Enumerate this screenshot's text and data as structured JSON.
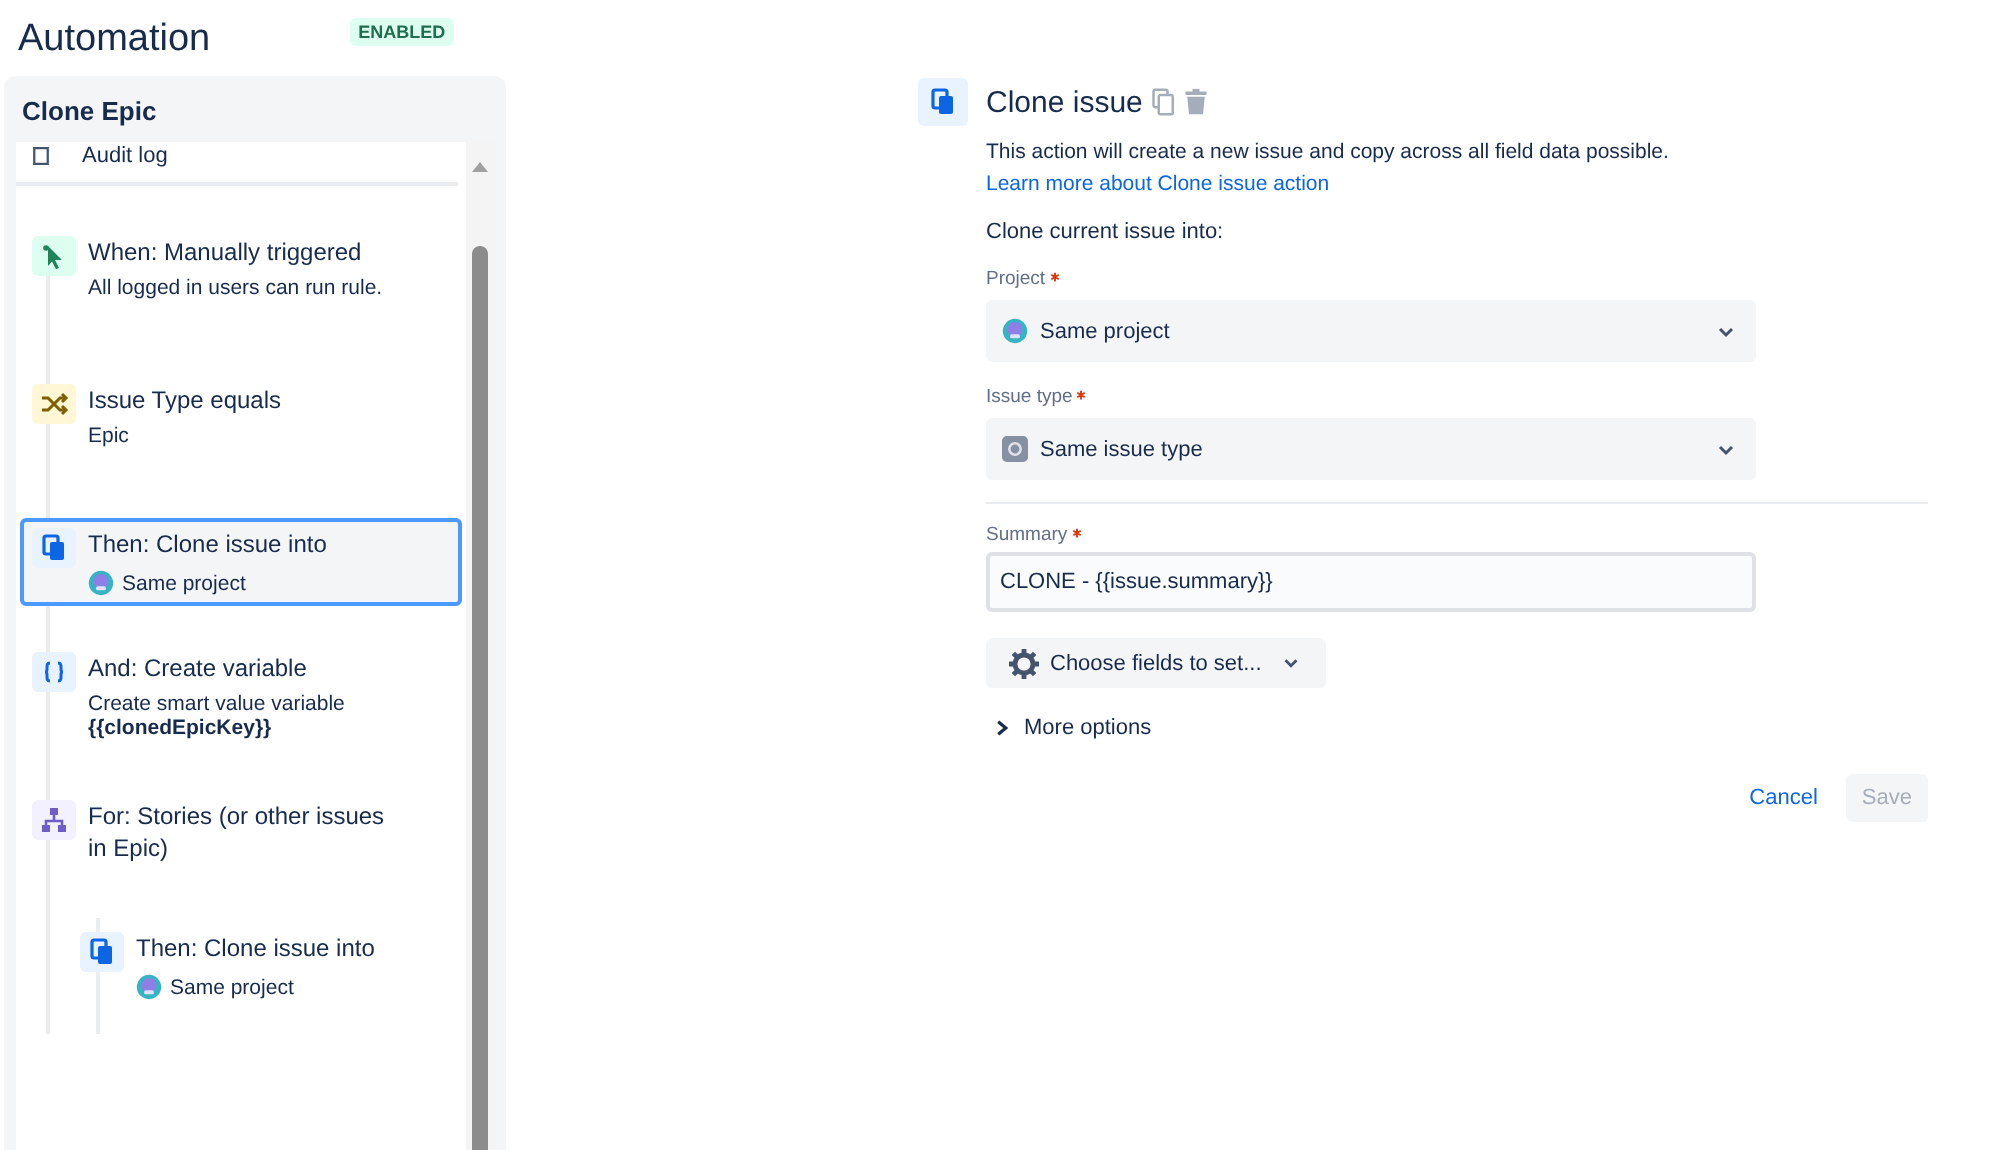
{
  "header": {
    "title": "Automation",
    "status": "ENABLED"
  },
  "rule": {
    "name": "Clone Epic",
    "audit_log": "Audit log",
    "steps": [
      {
        "kind": "trigger",
        "title": "When: Manually triggered",
        "lines": [
          {
            "text": "All logged in users can run rule.",
            "bold": false
          }
        ],
        "selected": false
      },
      {
        "kind": "condition",
        "title": "Issue Type equals",
        "lines": [
          {
            "text": "Epic",
            "bold": false
          }
        ],
        "selected": false
      },
      {
        "kind": "action",
        "title": "Then: Clone issue into",
        "project": "Same project",
        "selected": true
      },
      {
        "kind": "variable",
        "title": "And: Create variable",
        "lines": [
          {
            "text": "Create smart value variable",
            "bold": false
          },
          {
            "text": "{{clonedEpicKey}}",
            "bold": true
          }
        ],
        "selected": false
      },
      {
        "kind": "branch",
        "title": "For: Stories (or other issues in Epic)",
        "selected": false,
        "children": [
          {
            "kind": "action",
            "title": "Then: Clone issue into",
            "project": "Same project",
            "selected": false
          }
        ]
      }
    ]
  },
  "editor": {
    "title": "Clone issue",
    "description": "This action will create a new issue and copy across all field data possible.",
    "link": "Learn more about Clone issue action",
    "subheading": "Clone current issue into:",
    "fields": [
      {
        "kind": "project",
        "label": "Project",
        "required": true,
        "value": "Same project"
      },
      {
        "kind": "issue_type",
        "label": "Issue type",
        "required": true,
        "value": "Same issue type"
      },
      {
        "kind": "text",
        "label": "Summary",
        "required": true,
        "value": "CLONE - {{issue.summary}}"
      }
    ],
    "choose_fields": "Choose fields to set...",
    "more_options": "More options",
    "expanded": false,
    "buttons": [
      {
        "label": "Cancel",
        "kind": "link",
        "disabled": false
      },
      {
        "label": "Save",
        "kind": "primary",
        "disabled": true
      }
    ]
  }
}
